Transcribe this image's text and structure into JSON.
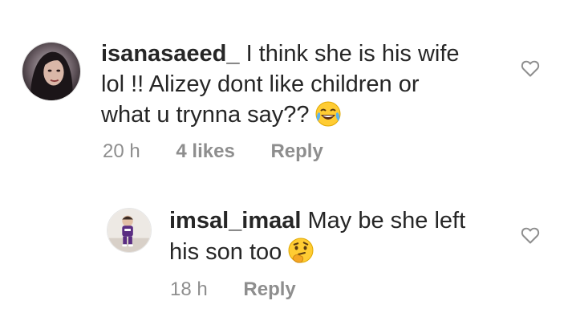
{
  "comments": [
    {
      "username": "isanasaeed_",
      "text_line1": " I think she is his wife",
      "text_line2": "lol !! Alizey dont like children or",
      "text_line3": "what u trynna say??",
      "emoji": "face-with-tears-of-joy",
      "time": "20 h",
      "likes": "4 likes",
      "reply_label": "Reply",
      "like_icon": "heart-outline-icon"
    },
    {
      "username": "imsal_imaal",
      "text_line1": " May be she left",
      "text_line2": "his son too",
      "emoji": "thinking-face",
      "time": "18 h",
      "reply_label": "Reply",
      "like_icon": "heart-outline-icon"
    }
  ],
  "colors": {
    "text": "#262626",
    "secondary": "#8e8e8e",
    "background": "#ffffff"
  }
}
